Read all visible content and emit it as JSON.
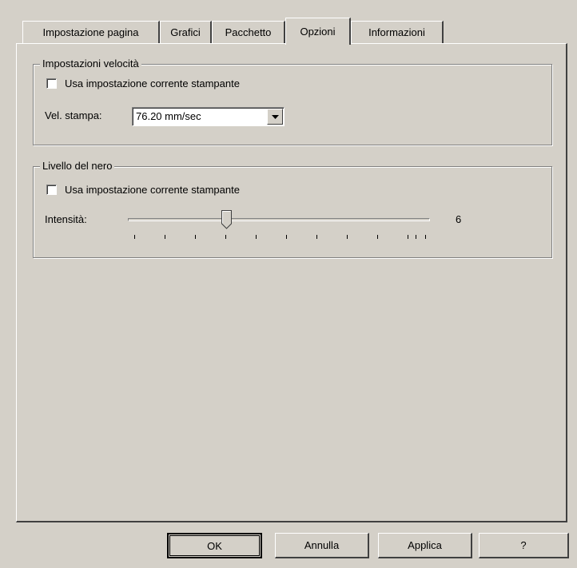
{
  "tabs": [
    {
      "label": "Impostazione pagina"
    },
    {
      "label": "Grafici"
    },
    {
      "label": "Pacchetto"
    },
    {
      "label": "Opzioni"
    },
    {
      "label": "Informazioni"
    }
  ],
  "speed_group": {
    "title": "Impostazioni velocità",
    "checkbox_label": "Usa impostazione corrente stampante",
    "speed_label": "Vel. stampa:",
    "speed_value": "76.20 mm/sec"
  },
  "darkness_group": {
    "title": "Livello del nero",
    "checkbox_label": "Usa impostazione corrente stampante",
    "intensity_label": "Intensità:",
    "intensity_value": "6"
  },
  "buttons": {
    "ok": "OK",
    "cancel": "Annulla",
    "apply": "Applica",
    "help": "?"
  },
  "icons": {
    "combo_arrow": "chevron-down-icon",
    "slider_thumb": "slider-thumb-icon"
  }
}
